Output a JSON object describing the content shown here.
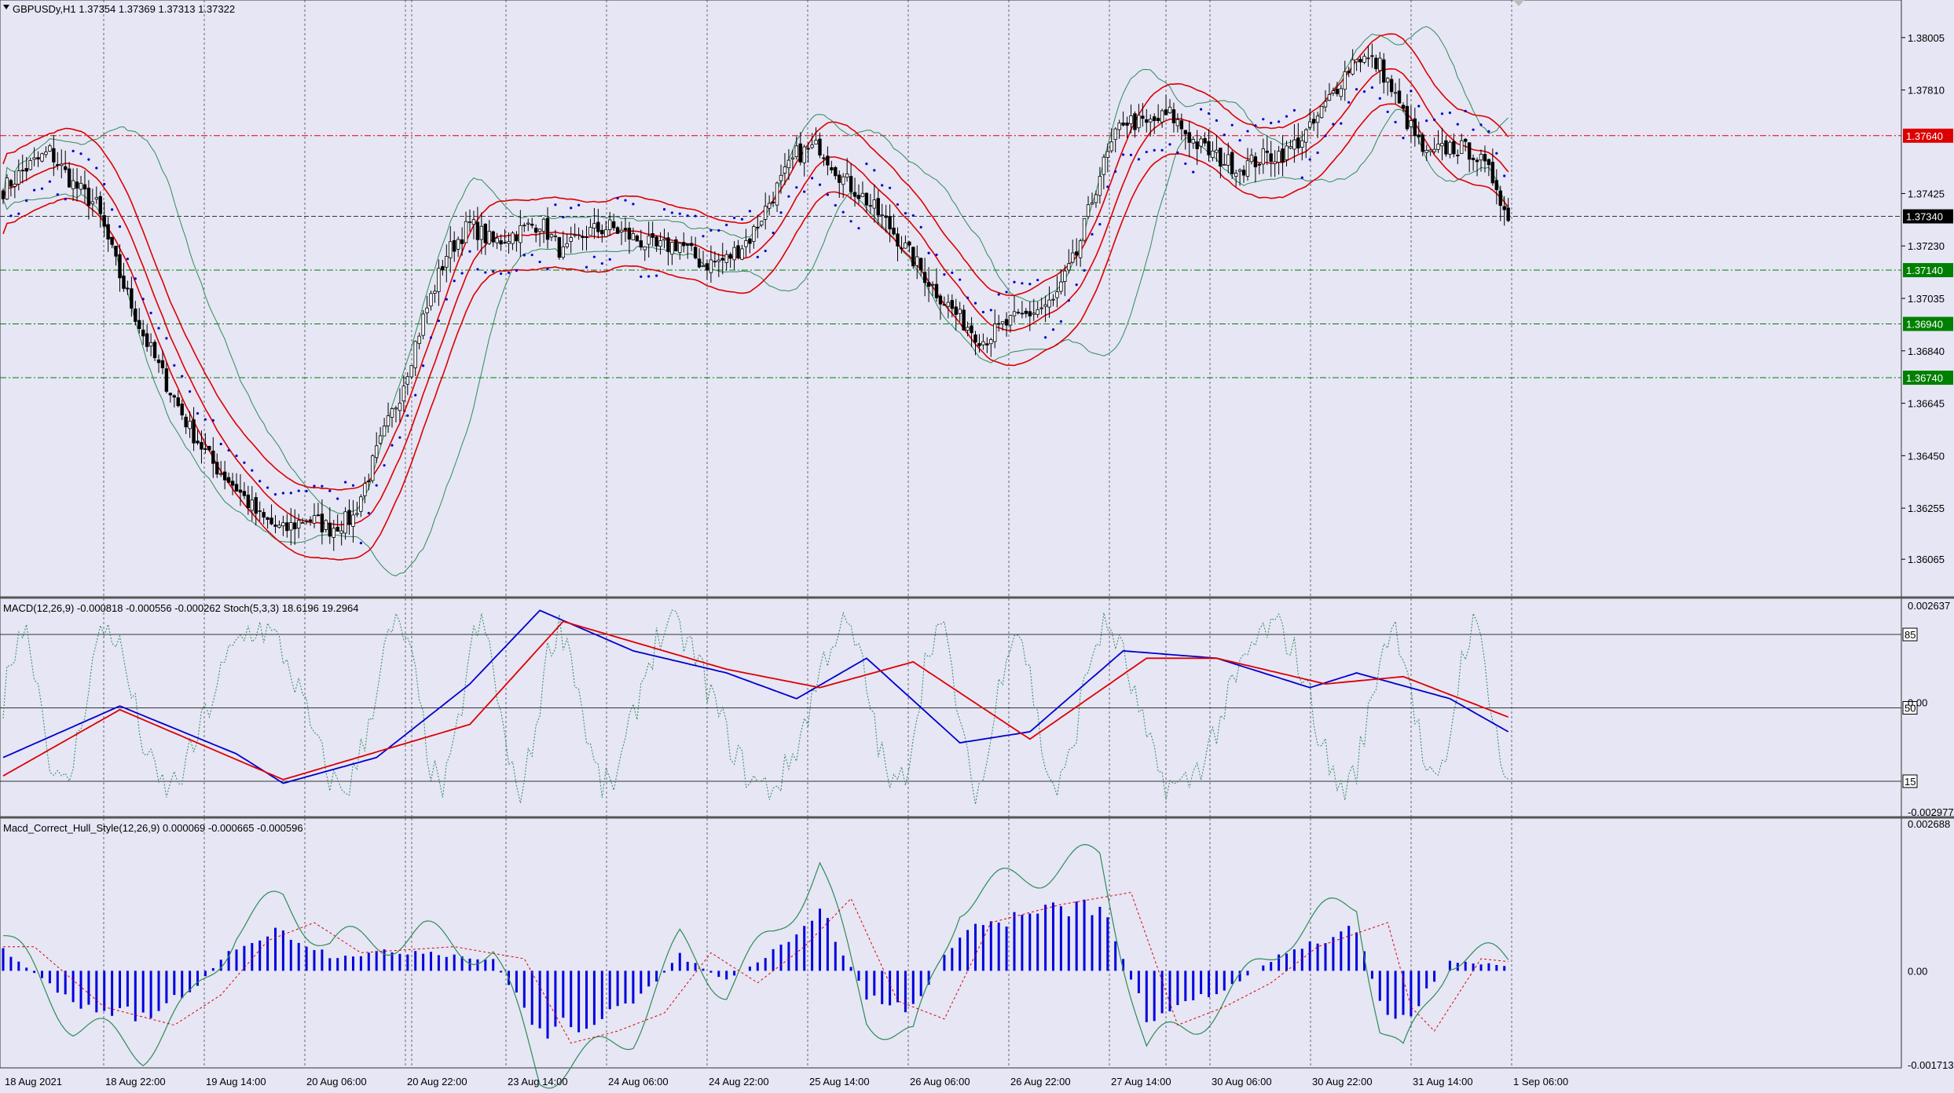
{
  "header": {
    "main_title": "GBPUSDy,H1  1.37354 1.37369 1.37313 1.37322",
    "macd_title": "MACD(12,26,9) -0.000818 -0.000556 -0.000262  Stoch(5,3,3) 18.6196 19.2964",
    "hull_title": "Macd_Correct_Hull_Style(12,26,9) 0.000069 -0.000665 -0.000596"
  },
  "colors": {
    "background": "#e6e6f5",
    "bull_candle": "#ffffff",
    "bear_candle": "#000000",
    "bollinger": "#2e8b57",
    "envelope": "#dd0000",
    "parabolic_sar": "#0000cc",
    "macd_line": "#0000cc",
    "signal_line": "#dd0000",
    "stochastic": "#2e8b57",
    "histogram": "#0000dd",
    "level_red": "#dd0000",
    "level_green": "#008000",
    "current_price_tag": "#000000"
  },
  "chart_data": [
    {
      "type": "candlestick",
      "symbol": "GBPUSDy",
      "timeframe": "H1",
      "x_labels": [
        "18 Aug 2021",
        "18 Aug 22:00",
        "19 Aug 14:00",
        "20 Aug 06:00",
        "20 Aug 22:00",
        "23 Aug 14:00",
        "24 Aug 06:00",
        "24 Aug 22:00",
        "25 Aug 14:00",
        "26 Aug 06:00",
        "26 Aug 22:00",
        "27 Aug 14:00",
        "30 Aug 06:00",
        "30 Aug 22:00",
        "31 Aug 14:00",
        "1 Sep 06:00"
      ],
      "y_ticks": [
        "1.38005",
        "1.37810",
        "1.37425",
        "1.37230",
        "1.37035",
        "1.36840",
        "1.36645",
        "1.36450",
        "1.36255",
        "1.36065"
      ],
      "ylim": [
        1.3594,
        1.3813
      ],
      "price_levels": [
        {
          "label": "1.37640",
          "color": "red"
        },
        {
          "label": "1.37340",
          "color": "black"
        },
        {
          "label": "1.37140",
          "color": "green"
        },
        {
          "label": "1.36940",
          "color": "green"
        },
        {
          "label": "1.36740",
          "color": "green"
        }
      ],
      "close_path": [
        [
          0,
          1.3744
        ],
        [
          6,
          1.3752
        ],
        [
          12,
          1.3758
        ],
        [
          18,
          1.3746
        ],
        [
          24,
          1.3738
        ],
        [
          30,
          1.3712
        ],
        [
          36,
          1.369
        ],
        [
          42,
          1.3672
        ],
        [
          48,
          1.3655
        ],
        [
          54,
          1.3642
        ],
        [
          60,
          1.3633
        ],
        [
          66,
          1.3622
        ],
        [
          72,
          1.3617
        ],
        [
          78,
          1.3622
        ],
        [
          84,
          1.3618
        ],
        [
          90,
          1.3622
        ],
        [
          96,
          1.3646
        ],
        [
          102,
          1.3668
        ],
        [
          108,
          1.3696
        ],
        [
          114,
          1.372
        ],
        [
          120,
          1.3731
        ],
        [
          126,
          1.3724
        ],
        [
          132,
          1.3728
        ],
        [
          138,
          1.3732
        ],
        [
          144,
          1.372
        ],
        [
          150,
          1.3728
        ],
        [
          156,
          1.373
        ],
        [
          162,
          1.3726
        ],
        [
          168,
          1.3722
        ],
        [
          174,
          1.3724
        ],
        [
          180,
          1.3716
        ],
        [
          186,
          1.3718
        ],
        [
          192,
          1.3726
        ],
        [
          198,
          1.3742
        ],
        [
          204,
          1.3757
        ],
        [
          210,
          1.376
        ],
        [
          216,
          1.3748
        ],
        [
          222,
          1.374
        ],
        [
          228,
          1.373
        ],
        [
          234,
          1.3718
        ],
        [
          240,
          1.3706
        ],
        [
          246,
          1.3696
        ],
        [
          252,
          1.3688
        ],
        [
          258,
          1.3694
        ],
        [
          264,
          1.3698
        ],
        [
          270,
          1.3702
        ],
        [
          276,
          1.372
        ],
        [
          282,
          1.375
        ],
        [
          288,
          1.377
        ],
        [
          294,
          1.3768
        ],
        [
          300,
          1.3772
        ],
        [
          306,
          1.3762
        ],
        [
          312,
          1.3756
        ],
        [
          318,
          1.3752
        ],
        [
          324,
          1.3756
        ],
        [
          330,
          1.3758
        ],
        [
          336,
          1.3766
        ],
        [
          342,
          1.378
        ],
        [
          348,
          1.3794
        ],
        [
          354,
          1.379
        ],
        [
          360,
          1.3772
        ],
        [
          366,
          1.3756
        ],
        [
          372,
          1.376
        ],
        [
          378,
          1.3758
        ],
        [
          384,
          1.3746
        ],
        [
          387,
          1.3732
        ]
      ],
      "overlays": [
        "Bollinger Bands",
        "Envelopes",
        "Parabolic SAR"
      ]
    },
    {
      "type": "line",
      "panel": "MACD(12,26,9) / Stoch(5,3,3)",
      "y_ticks": [
        "0.002637",
        "0.00",
        "-0.002977"
      ],
      "stoch_levels": [
        "85",
        "50",
        "15"
      ],
      "series": [
        {
          "name": "MACD",
          "points": [
            [
              0,
              -0.0015
            ],
            [
              30,
              -0.0001
            ],
            [
              60,
              -0.0014
            ],
            [
              72,
              -0.0022
            ],
            [
              96,
              -0.0015
            ],
            [
              120,
              0.0005
            ],
            [
              138,
              0.0025
            ],
            [
              162,
              0.0014
            ],
            [
              186,
              0.0008
            ],
            [
              204,
              0.0001
            ],
            [
              222,
              0.0012
            ],
            [
              246,
              -0.0011
            ],
            [
              264,
              -0.0008
            ],
            [
              288,
              0.0014
            ],
            [
              312,
              0.0012
            ],
            [
              336,
              0.0004
            ],
            [
              348,
              0.0008
            ],
            [
              372,
              0.0001
            ],
            [
              387,
              -0.0008
            ]
          ]
        },
        {
          "name": "Signal",
          "points": [
            [
              0,
              -0.002
            ],
            [
              30,
              -0.0002
            ],
            [
              72,
              -0.0021
            ],
            [
              120,
              -0.0006
            ],
            [
              144,
              0.0022
            ],
            [
              186,
              0.0009
            ],
            [
              210,
              0.0004
            ],
            [
              234,
              0.0011
            ],
            [
              264,
              -0.001
            ],
            [
              294,
              0.0012
            ],
            [
              312,
              0.0012
            ],
            [
              340,
              0.0005
            ],
            [
              360,
              0.0007
            ],
            [
              387,
              -0.0004
            ]
          ]
        }
      ]
    },
    {
      "type": "bar",
      "panel": "Macd_Correct_Hull_Style(12,26,9)",
      "y_ticks": [
        "0.002688",
        "0.00",
        "-0.001713"
      ],
      "histogram_shape": [
        [
          0,
          0.0004
        ],
        [
          18,
          -0.0006
        ],
        [
          36,
          -0.0009
        ],
        [
          48,
          -0.0004
        ],
        [
          60,
          0.0005
        ],
        [
          72,
          0.0008
        ],
        [
          84,
          0.0003
        ],
        [
          108,
          0.0004
        ],
        [
          126,
          0.0002
        ],
        [
          138,
          -0.0012
        ],
        [
          150,
          -0.001
        ],
        [
          162,
          -0.0007
        ],
        [
          174,
          0.0003
        ],
        [
          186,
          -0.0002
        ],
        [
          198,
          0.0004
        ],
        [
          210,
          0.0012
        ],
        [
          222,
          -0.0005
        ],
        [
          234,
          -0.0008
        ],
        [
          246,
          0.0008
        ],
        [
          264,
          0.0011
        ],
        [
          282,
          0.0013
        ],
        [
          294,
          -0.0009
        ],
        [
          306,
          -0.0006
        ],
        [
          318,
          -0.0002
        ],
        [
          330,
          0.0004
        ],
        [
          348,
          0.0008
        ],
        [
          354,
          -0.0006
        ],
        [
          360,
          -0.001
        ],
        [
          372,
          0.0002
        ],
        [
          387,
          0.0001
        ]
      ]
    }
  ]
}
